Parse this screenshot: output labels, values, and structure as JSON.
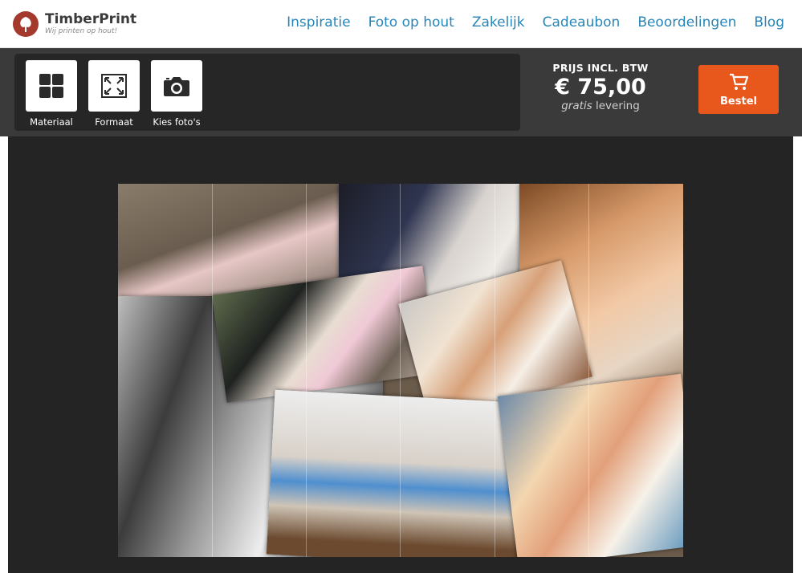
{
  "brand": {
    "name": "TimberPrint",
    "tagline": "Wij printen op hout!"
  },
  "nav": [
    {
      "label": "Inspiratie"
    },
    {
      "label": "Foto op hout"
    },
    {
      "label": "Zakelijk"
    },
    {
      "label": "Cadeaubon"
    },
    {
      "label": "Beoordelingen"
    },
    {
      "label": "Blog"
    }
  ],
  "tools": [
    {
      "label": "Materiaal",
      "icon": "grid-icon"
    },
    {
      "label": "Formaat",
      "icon": "resize-icon"
    },
    {
      "label": "Kies foto's",
      "icon": "camera-icon"
    }
  ],
  "price": {
    "title": "PRIJS INCL. BTW",
    "amount": "€ 75,00",
    "sub_em": "gratis",
    "sub_rest": "levering"
  },
  "order": {
    "label": "Bestel",
    "icon": "cart-icon"
  },
  "colors": {
    "accent": "#e8571b",
    "nav_link": "#2785b8",
    "toolbar_bg": "#3a3a3a",
    "stage_bg": "#242424"
  }
}
